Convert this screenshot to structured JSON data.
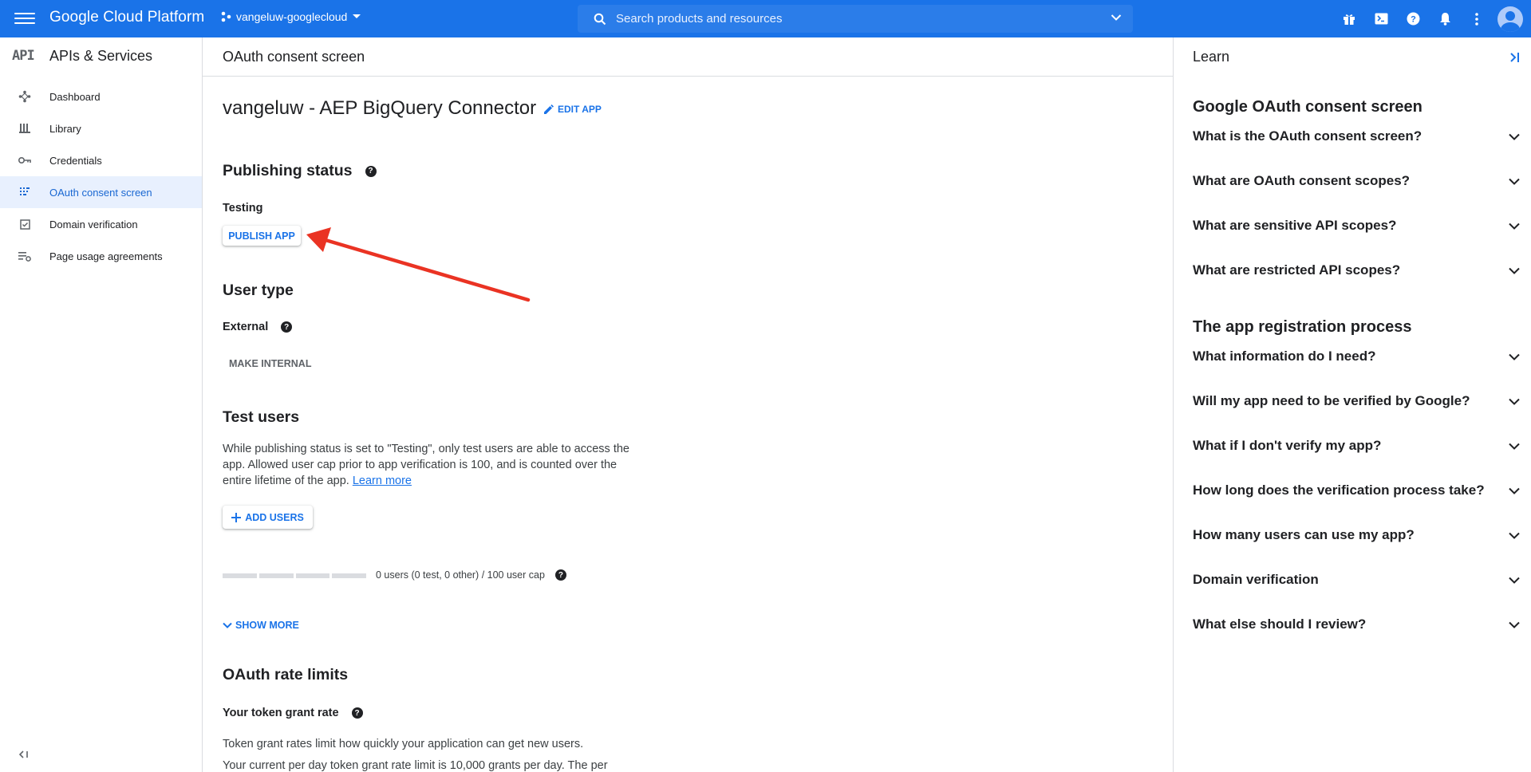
{
  "topbar": {
    "brand": "Google Cloud Platform",
    "project": "vangeluw-googlecloud",
    "search_placeholder": "Search products and resources"
  },
  "sidebar": {
    "api_badge": "API",
    "title": "APIs & Services",
    "items": [
      {
        "label": "Dashboard",
        "icon": "dashboard-icon"
      },
      {
        "label": "Library",
        "icon": "library-icon"
      },
      {
        "label": "Credentials",
        "icon": "key-icon"
      },
      {
        "label": "OAuth consent screen",
        "icon": "consent-icon",
        "active": true
      },
      {
        "label": "Domain verification",
        "icon": "checkbox-icon"
      },
      {
        "label": "Page usage agreements",
        "icon": "settings-list-icon"
      }
    ]
  },
  "main": {
    "header": "OAuth consent screen",
    "app_title": "vangeluw - AEP BigQuery Connector",
    "edit_app": "EDIT APP",
    "publishing_status": {
      "heading": "Publishing status",
      "status": "Testing",
      "publish_button": "PUBLISH APP"
    },
    "user_type": {
      "heading": "User type",
      "value": "External",
      "make_internal": "MAKE INTERNAL"
    },
    "test_users": {
      "heading": "Test users",
      "description": "While publishing status is set to \"Testing\", only test users are able to access the app. Allowed user cap prior to app verification is 100, and is counted over the entire lifetime of the app.",
      "learn_more": "Learn more",
      "add_users": "ADD USERS",
      "usage_text": "0 users (0 test, 0 other) / 100 user cap",
      "usage_fraction": 0,
      "show_more": "SHOW MORE"
    },
    "rate_limits": {
      "heading": "OAuth rate limits",
      "subheading": "Your token grant rate",
      "line1": "Token grant rates limit how quickly your application can get new users.",
      "line2": "Your current per day token grant rate limit is 10,000 grants per day. The per"
    }
  },
  "learn": {
    "header": "Learn",
    "sections": [
      {
        "title": "Google OAuth consent screen",
        "questions": [
          "What is the OAuth consent screen?",
          "What are OAuth consent scopes?",
          "What are sensitive API scopes?",
          "What are restricted API scopes?"
        ]
      },
      {
        "title": "The app registration process",
        "questions": [
          "What information do I need?",
          "Will my app need to be verified by Google?",
          "What if I don't verify my app?",
          "How long does the verification process take?",
          "How many users can use my app?",
          "Domain verification",
          "What else should I review?"
        ]
      }
    ]
  },
  "colors": {
    "topbar": "#1a73e8",
    "accent": "#1a73e8",
    "active_bg": "#e8f0fe",
    "annotation_arrow": "#ea3323"
  }
}
